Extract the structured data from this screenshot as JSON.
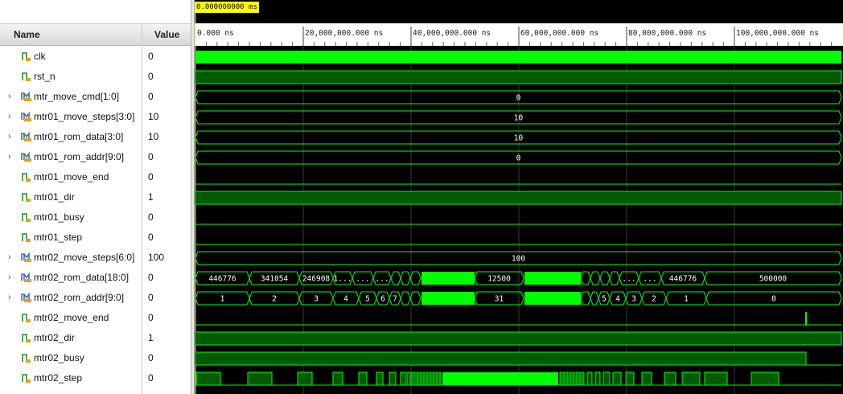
{
  "cursor": {
    "time": "0.000000000 ms"
  },
  "columns": {
    "name": "Name",
    "value": "Value"
  },
  "timeline": {
    "ticks": [
      "0.000 ns",
      "20,000,000.000 ns",
      "40,000,000.000 ns",
      "60,000,000.000 ns",
      "80,000,000.000 ns",
      "100,000,000.000 ns"
    ]
  },
  "colors": {
    "wave": "#00ff00",
    "wave_dim": "#005a00",
    "bus": "#00ff00",
    "cursor": "#ffff00"
  },
  "signals": [
    {
      "name": "clk",
      "value": "0",
      "kind": "bit",
      "icon": "signal-icon"
    },
    {
      "name": "rst_n",
      "value": "0",
      "kind": "bit",
      "icon": "signal-icon"
    },
    {
      "name": "mtr_move_cmd[1:0]",
      "value": "0",
      "kind": "bus",
      "icon": "bus-icon",
      "bus_value": "0"
    },
    {
      "name": "mtr01_move_steps[3:0]",
      "value": "10",
      "kind": "bus",
      "icon": "bus-icon",
      "bus_value": "10"
    },
    {
      "name": "mtr01_rom_data[3:0]",
      "value": "10",
      "kind": "bus",
      "icon": "bus-icon",
      "bus_value": "10"
    },
    {
      "name": "mtr01_rom_addr[9:0]",
      "value": "0",
      "kind": "bus",
      "icon": "bus-icon",
      "bus_value": "0"
    },
    {
      "name": "mtr01_move_end",
      "value": "0",
      "kind": "bit",
      "icon": "signal-icon"
    },
    {
      "name": "mtr01_dir",
      "value": "1",
      "kind": "bit",
      "icon": "signal-icon"
    },
    {
      "name": "mtr01_busy",
      "value": "0",
      "kind": "bit",
      "icon": "signal-icon"
    },
    {
      "name": "mtr01_step",
      "value": "0",
      "kind": "bit",
      "icon": "signal-icon"
    },
    {
      "name": "mtr02_move_steps[6:0]",
      "value": "100",
      "kind": "bus",
      "icon": "bus-icon",
      "bus_value": "100"
    },
    {
      "name": "mtr02_rom_data[18:0]",
      "value": "0",
      "kind": "bus",
      "icon": "bus-icon",
      "segments": [
        "446776",
        "341054",
        "246908",
        "1...",
        "...",
        "...",
        "12500",
        "...",
        "...",
        "3...",
        "446776",
        "500000"
      ]
    },
    {
      "name": "mtr02_rom_addr[9:0]",
      "value": "0",
      "kind": "bus",
      "icon": "bus-icon",
      "segments": [
        "1",
        "2",
        "3",
        "4",
        "5",
        "6",
        "7",
        "31",
        "5",
        "4",
        "3",
        "2",
        "1",
        "0"
      ]
    },
    {
      "name": "mtr02_move_end",
      "value": "0",
      "kind": "bit",
      "icon": "signal-icon"
    },
    {
      "name": "mtr02_dir",
      "value": "1",
      "kind": "bit",
      "icon": "signal-icon"
    },
    {
      "name": "mtr02_busy",
      "value": "0",
      "kind": "bit",
      "icon": "signal-icon"
    },
    {
      "name": "mtr02_step",
      "value": "0",
      "kind": "bit",
      "icon": "signal-icon"
    }
  ]
}
